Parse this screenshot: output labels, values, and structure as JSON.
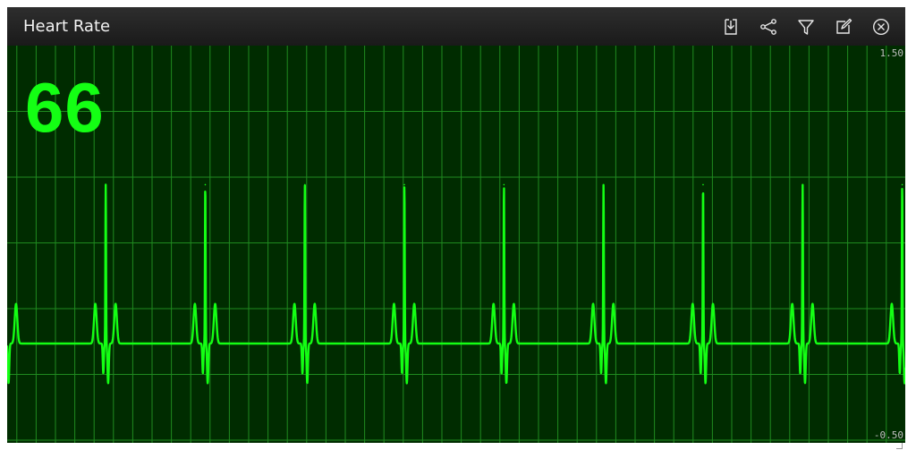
{
  "window": {
    "title": "Heart Rate"
  },
  "toolbar": {
    "items": [
      {
        "name": "download-icon"
      },
      {
        "name": "share-icon"
      },
      {
        "name": "filter-icon"
      },
      {
        "name": "edit-icon"
      },
      {
        "name": "close-icon"
      }
    ]
  },
  "colors": {
    "trace": "#14ff14",
    "grid": "#1f8a1f",
    "background": "#002c00",
    "titlebar": "#222222"
  },
  "chart_data": {
    "type": "line",
    "title": "",
    "xlabel": "",
    "ylabel": "",
    "ylim": [
      -0.5,
      1.5
    ],
    "y_tick_labels": [
      "1.50",
      "-0.50"
    ],
    "grid": true,
    "heart_rate_value": "66",
    "beats": 9,
    "beat_period_s": 0.909,
    "x_range_s": [
      0,
      8.2
    ],
    "waveform": {
      "baseline": 0.0,
      "p_wave": 0.2,
      "q_dip": -0.15,
      "r_peak": 0.8,
      "s_dip": -0.2,
      "t_wave": 0.2
    }
  }
}
